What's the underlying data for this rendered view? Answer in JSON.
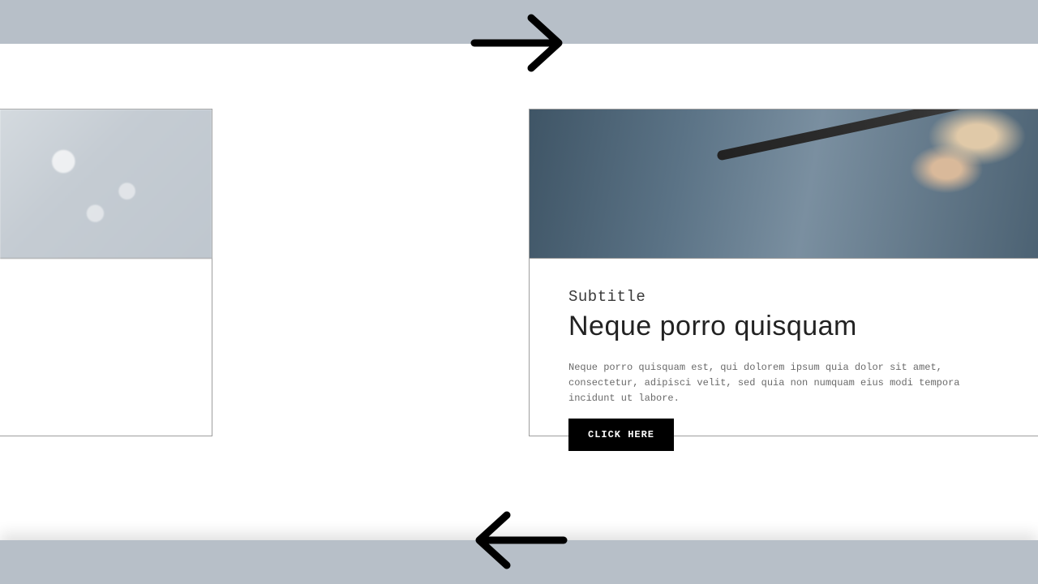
{
  "card": {
    "subtitle": "Subtitle",
    "title": "Neque porro quisquam",
    "description": "Neque porro quisquam est, qui dolorem ipsum quia dolor sit amet, consectetur, adipisci velit, sed quia non numquam eius modi tempora incidunt ut labore.",
    "cta_label": "CLICK HERE"
  }
}
